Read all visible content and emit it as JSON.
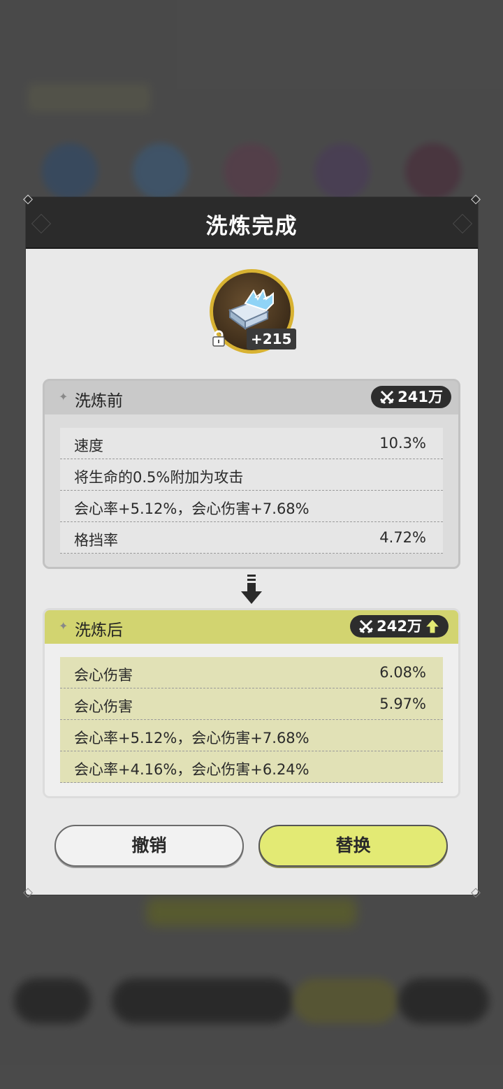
{
  "dialog": {
    "title": "洗炼完成"
  },
  "item": {
    "level": "+215",
    "locked": true,
    "icon": "crystal-book-icon"
  },
  "before": {
    "label": "洗炼前",
    "power": "241万",
    "stats": [
      {
        "name": "速度",
        "value": "10.3%"
      },
      {
        "name": "将生命的0.5%附加为攻击",
        "value": ""
      },
      {
        "name": "会心率+5.12%，会心伤害+7.68%",
        "value": ""
      },
      {
        "name": "格挡率",
        "value": "4.72%"
      }
    ]
  },
  "after": {
    "label": "洗炼后",
    "power": "242万",
    "stats": [
      {
        "name": "会心伤害",
        "value": "6.08%"
      },
      {
        "name": "会心伤害",
        "value": "5.97%"
      },
      {
        "name": "会心率+5.12%，会心伤害+7.68%",
        "value": ""
      },
      {
        "name": "会心率+4.16%，会心伤害+6.24%",
        "value": ""
      }
    ]
  },
  "buttons": {
    "cancel": "撤销",
    "replace": "替换"
  },
  "colors": {
    "accent_yellow": "#d2d470",
    "button_yellow": "#e3ea74",
    "header_dark": "#2b2b2b",
    "icon_gold": "#d8b232"
  }
}
